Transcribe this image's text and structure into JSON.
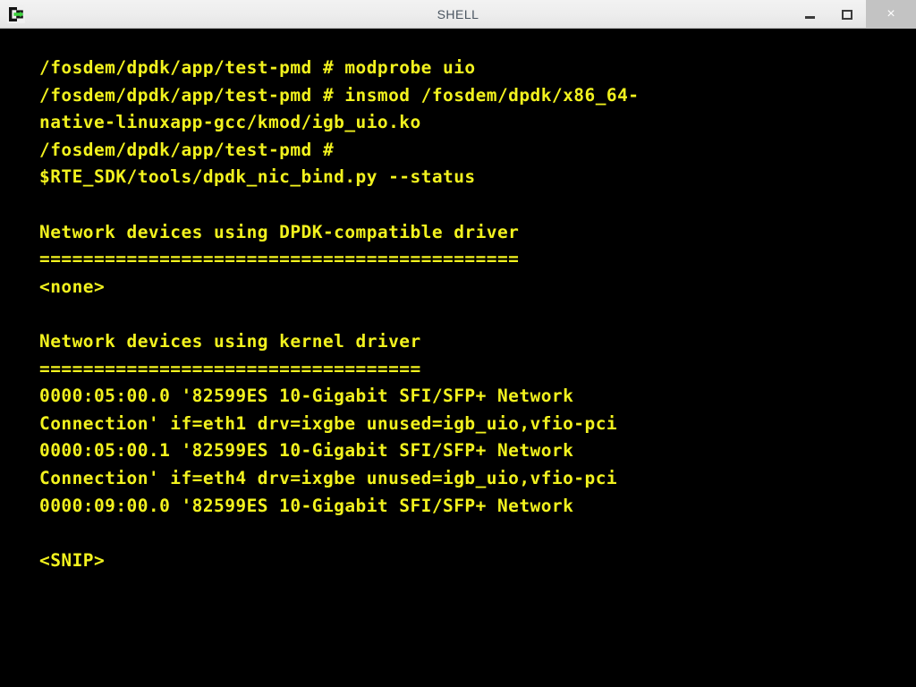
{
  "window": {
    "title": "SHELL",
    "icon": "terminal-shell-icon",
    "titlebar_bg": "#ededed",
    "title_color": "#4a5560",
    "controls": {
      "minimize_label": "–",
      "minimize_name": "minimize-icon",
      "maximize_label": "□",
      "maximize_name": "maximize-icon",
      "close_label": "×",
      "close_name": "close-icon",
      "close_bg": "#c3c3c3"
    }
  },
  "terminal": {
    "background": "#000000",
    "foreground": "#f2f21e",
    "font": "monospace-bold",
    "columns": 63,
    "lines": [
      "/fosdem/dpdk/app/test-pmd # modprobe uio",
      "/fosdem/dpdk/app/test-pmd # insmod /fosdem/dpdk/x86_64-",
      "native-linuxapp-gcc/kmod/igb_uio.ko",
      "/fosdem/dpdk/app/test-pmd # ",
      "$RTE_SDK/tools/dpdk_nic_bind.py --status",
      "",
      "Network devices using DPDK-compatible driver",
      "============================================",
      "<none>",
      "",
      "Network devices using kernel driver",
      "===================================",
      "0000:05:00.0 '82599ES 10-Gigabit SFI/SFP+ Network",
      "Connection' if=eth1 drv=ixgbe unused=igb_uio,vfio-pci",
      "0000:05:00.1 '82599ES 10-Gigabit SFI/SFP+ Network",
      "Connection' if=eth4 drv=ixgbe unused=igb_uio,vfio-pci",
      "0000:09:00.0 '82599ES 10-Gigabit SFI/SFP+ Network",
      "",
      "<SNIP>"
    ]
  }
}
